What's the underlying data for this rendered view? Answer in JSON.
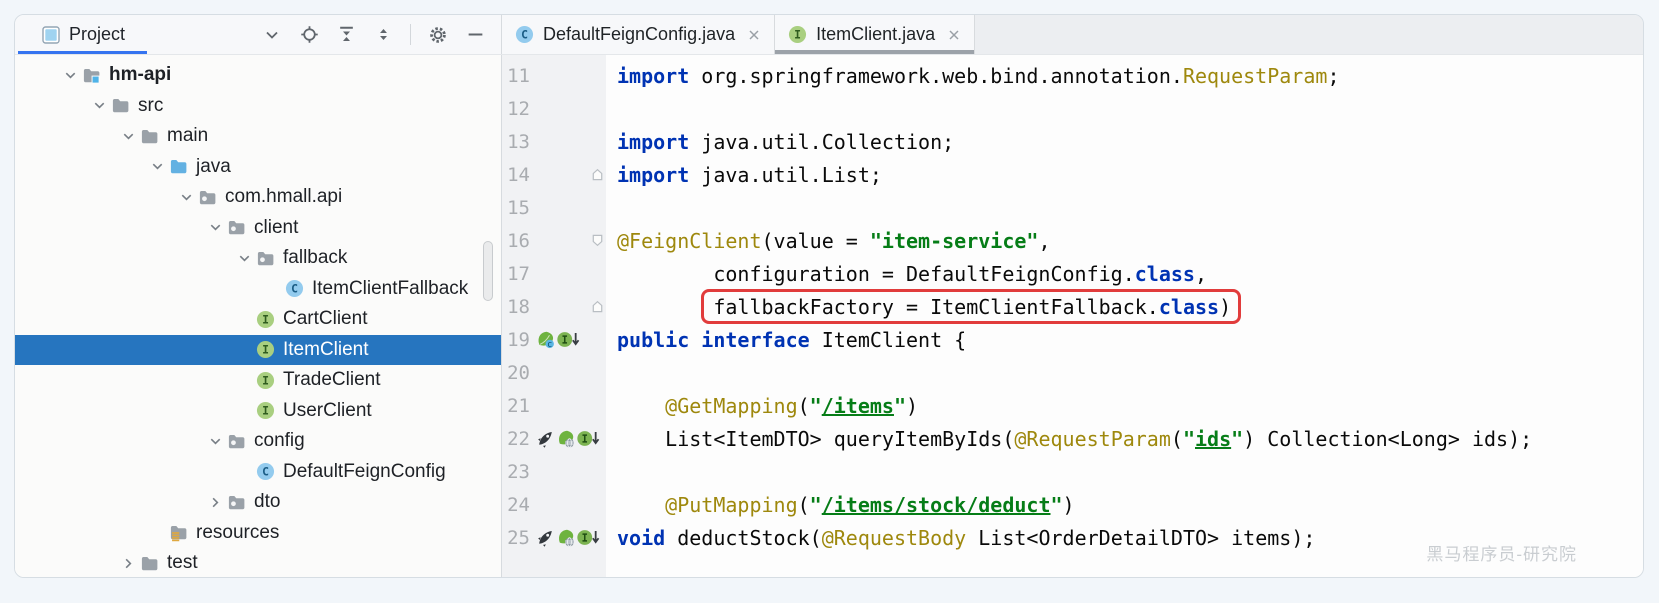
{
  "project_panel": {
    "title": "Project",
    "toolbar": [
      {
        "name": "chevron-down",
        "action": "view-options"
      },
      {
        "name": "locate",
        "action": "select-opened-file"
      },
      {
        "name": "expand-all",
        "action": "expand-all"
      },
      {
        "name": "collapse-all",
        "action": "collapse-all"
      },
      {
        "name": "separator"
      },
      {
        "name": "settings-gear",
        "action": "settings"
      },
      {
        "name": "hide-panel",
        "action": "hide"
      }
    ],
    "tree": [
      {
        "label": "hm-api",
        "icon": "module-folder",
        "depth": 0,
        "chevron": "expanded",
        "bold": true
      },
      {
        "label": "src",
        "icon": "folder",
        "depth": 1,
        "chevron": "expanded"
      },
      {
        "label": "main",
        "icon": "folder",
        "depth": 2,
        "chevron": "expanded"
      },
      {
        "label": "java",
        "icon": "sources-folder",
        "depth": 3,
        "chevron": "expanded"
      },
      {
        "label": "com.hmall.api",
        "icon": "package-folder",
        "depth": 4,
        "chevron": "expanded"
      },
      {
        "label": "client",
        "icon": "package-folder",
        "depth": 5,
        "chevron": "expanded"
      },
      {
        "label": "fallback",
        "icon": "package-folder",
        "depth": 6,
        "chevron": "expanded"
      },
      {
        "label": "ItemClientFallback",
        "icon": "class",
        "depth": 7,
        "chevron": "none"
      },
      {
        "label": "CartClient",
        "icon": "interface",
        "depth": 6,
        "chevron": "none"
      },
      {
        "label": "ItemClient",
        "icon": "interface",
        "depth": 6,
        "chevron": "none",
        "selected": true
      },
      {
        "label": "TradeClient",
        "icon": "interface",
        "depth": 6,
        "chevron": "none"
      },
      {
        "label": "UserClient",
        "icon": "interface",
        "depth": 6,
        "chevron": "none"
      },
      {
        "label": "config",
        "icon": "package-folder",
        "depth": 5,
        "chevron": "expanded"
      },
      {
        "label": "DefaultFeignConfig",
        "icon": "class",
        "depth": 6,
        "chevron": "none"
      },
      {
        "label": "dto",
        "icon": "package-folder",
        "depth": 5,
        "chevron": "collapsed"
      },
      {
        "label": "resources",
        "icon": "resources-folder",
        "depth": 3,
        "chevron": "none"
      },
      {
        "label": "test",
        "icon": "folder",
        "depth": 2,
        "chevron": "collapsed"
      }
    ]
  },
  "editor": {
    "tabs": [
      {
        "label": "DefaultFeignConfig.java",
        "icon": "class",
        "active": false,
        "close": "x"
      },
      {
        "label": "ItemClient.java",
        "icon": "interface",
        "active": true,
        "close": "x"
      }
    ],
    "lines": [
      {
        "no": "11",
        "code": [
          [
            "kw",
            "import"
          ],
          [
            "pl",
            " org.springframework.web.bind.annotation."
          ],
          [
            "an",
            "RequestParam"
          ],
          [
            "pl",
            ";"
          ]
        ]
      },
      {
        "no": "12",
        "code": []
      },
      {
        "no": "13",
        "code": [
          [
            "kw",
            "import"
          ],
          [
            "pl",
            " java.util.Collection;"
          ]
        ]
      },
      {
        "no": "14",
        "fold": "up",
        "code": [
          [
            "kw",
            "import"
          ],
          [
            "pl",
            " java.util.List;"
          ]
        ]
      },
      {
        "no": "15",
        "code": []
      },
      {
        "no": "16",
        "fold": "down",
        "code": [
          [
            "an",
            "@FeignClient"
          ],
          [
            "pl",
            "(value = "
          ],
          [
            "st",
            "\"item-service\""
          ],
          [
            "pl",
            ","
          ]
        ]
      },
      {
        "no": "17",
        "code": [
          [
            "pl",
            "        configuration = DefaultFeignConfig."
          ],
          [
            "kw",
            "class"
          ],
          [
            "pl",
            ","
          ]
        ]
      },
      {
        "no": "18",
        "fold": "up",
        "code": [
          [
            "pl",
            "        fallbackFactory = ItemClientFallback."
          ],
          [
            "kw",
            "class"
          ],
          [
            "pl",
            ")"
          ]
        ]
      },
      {
        "no": "19",
        "icons": [
          "spring-bean",
          "implementations"
        ],
        "code": [
          [
            "kw",
            "public"
          ],
          [
            "pl",
            " "
          ],
          [
            "kw",
            "interface"
          ],
          [
            "pl",
            " ItemClient {"
          ]
        ]
      },
      {
        "no": "20",
        "code": []
      },
      {
        "no": "21",
        "code": [
          [
            "pl",
            "    "
          ],
          [
            "an",
            "@GetMapping"
          ],
          [
            "pl",
            "("
          ],
          [
            "st",
            "\""
          ],
          [
            "su",
            "/items"
          ],
          [
            "st",
            "\""
          ],
          [
            "pl",
            ")"
          ]
        ]
      },
      {
        "no": "22",
        "icons": [
          "rocket",
          "spring-endpoint",
          "implementations"
        ],
        "code": [
          [
            "pl",
            "    List<ItemDTO> queryItemByIds("
          ],
          [
            "an",
            "@RequestParam"
          ],
          [
            "pl",
            "("
          ],
          [
            "st",
            "\""
          ],
          [
            "su",
            "ids"
          ],
          [
            "st",
            "\""
          ],
          [
            "pl",
            ") Collection<Long> ids);"
          ]
        ]
      },
      {
        "no": "23",
        "code": []
      },
      {
        "no": "24",
        "code": [
          [
            "pl",
            "    "
          ],
          [
            "an",
            "@PutMapping"
          ],
          [
            "pl",
            "("
          ],
          [
            "st",
            "\""
          ],
          [
            "su",
            "/items/stock/deduct"
          ],
          [
            "st",
            "\""
          ],
          [
            "pl",
            ")"
          ]
        ]
      },
      {
        "no": "25",
        "icons": [
          "rocket",
          "spring-endpoint",
          "implementations"
        ],
        "code": [
          [
            "kw",
            "void"
          ],
          [
            "pl",
            " deductStock("
          ],
          [
            "an",
            "@RequestBody"
          ],
          [
            "pl",
            " List<OrderDetailDTO> items);"
          ]
        ]
      }
    ],
    "highlight": {
      "line": 18,
      "text": "fallbackFactory = ItemClientFallback.class",
      "color": "#E13C3C"
    }
  },
  "watermark": "黑马程序员-研究院",
  "colors": {
    "accent": "#3574F0",
    "tree_selection": "#2675BF",
    "keyword": "#0033B3",
    "annotation": "#9E880D",
    "string": "#067D17",
    "highlight_box": "#E13C3C",
    "editor_bg": "#FDFDFD",
    "gutter_bg": "#F1F2F4"
  }
}
